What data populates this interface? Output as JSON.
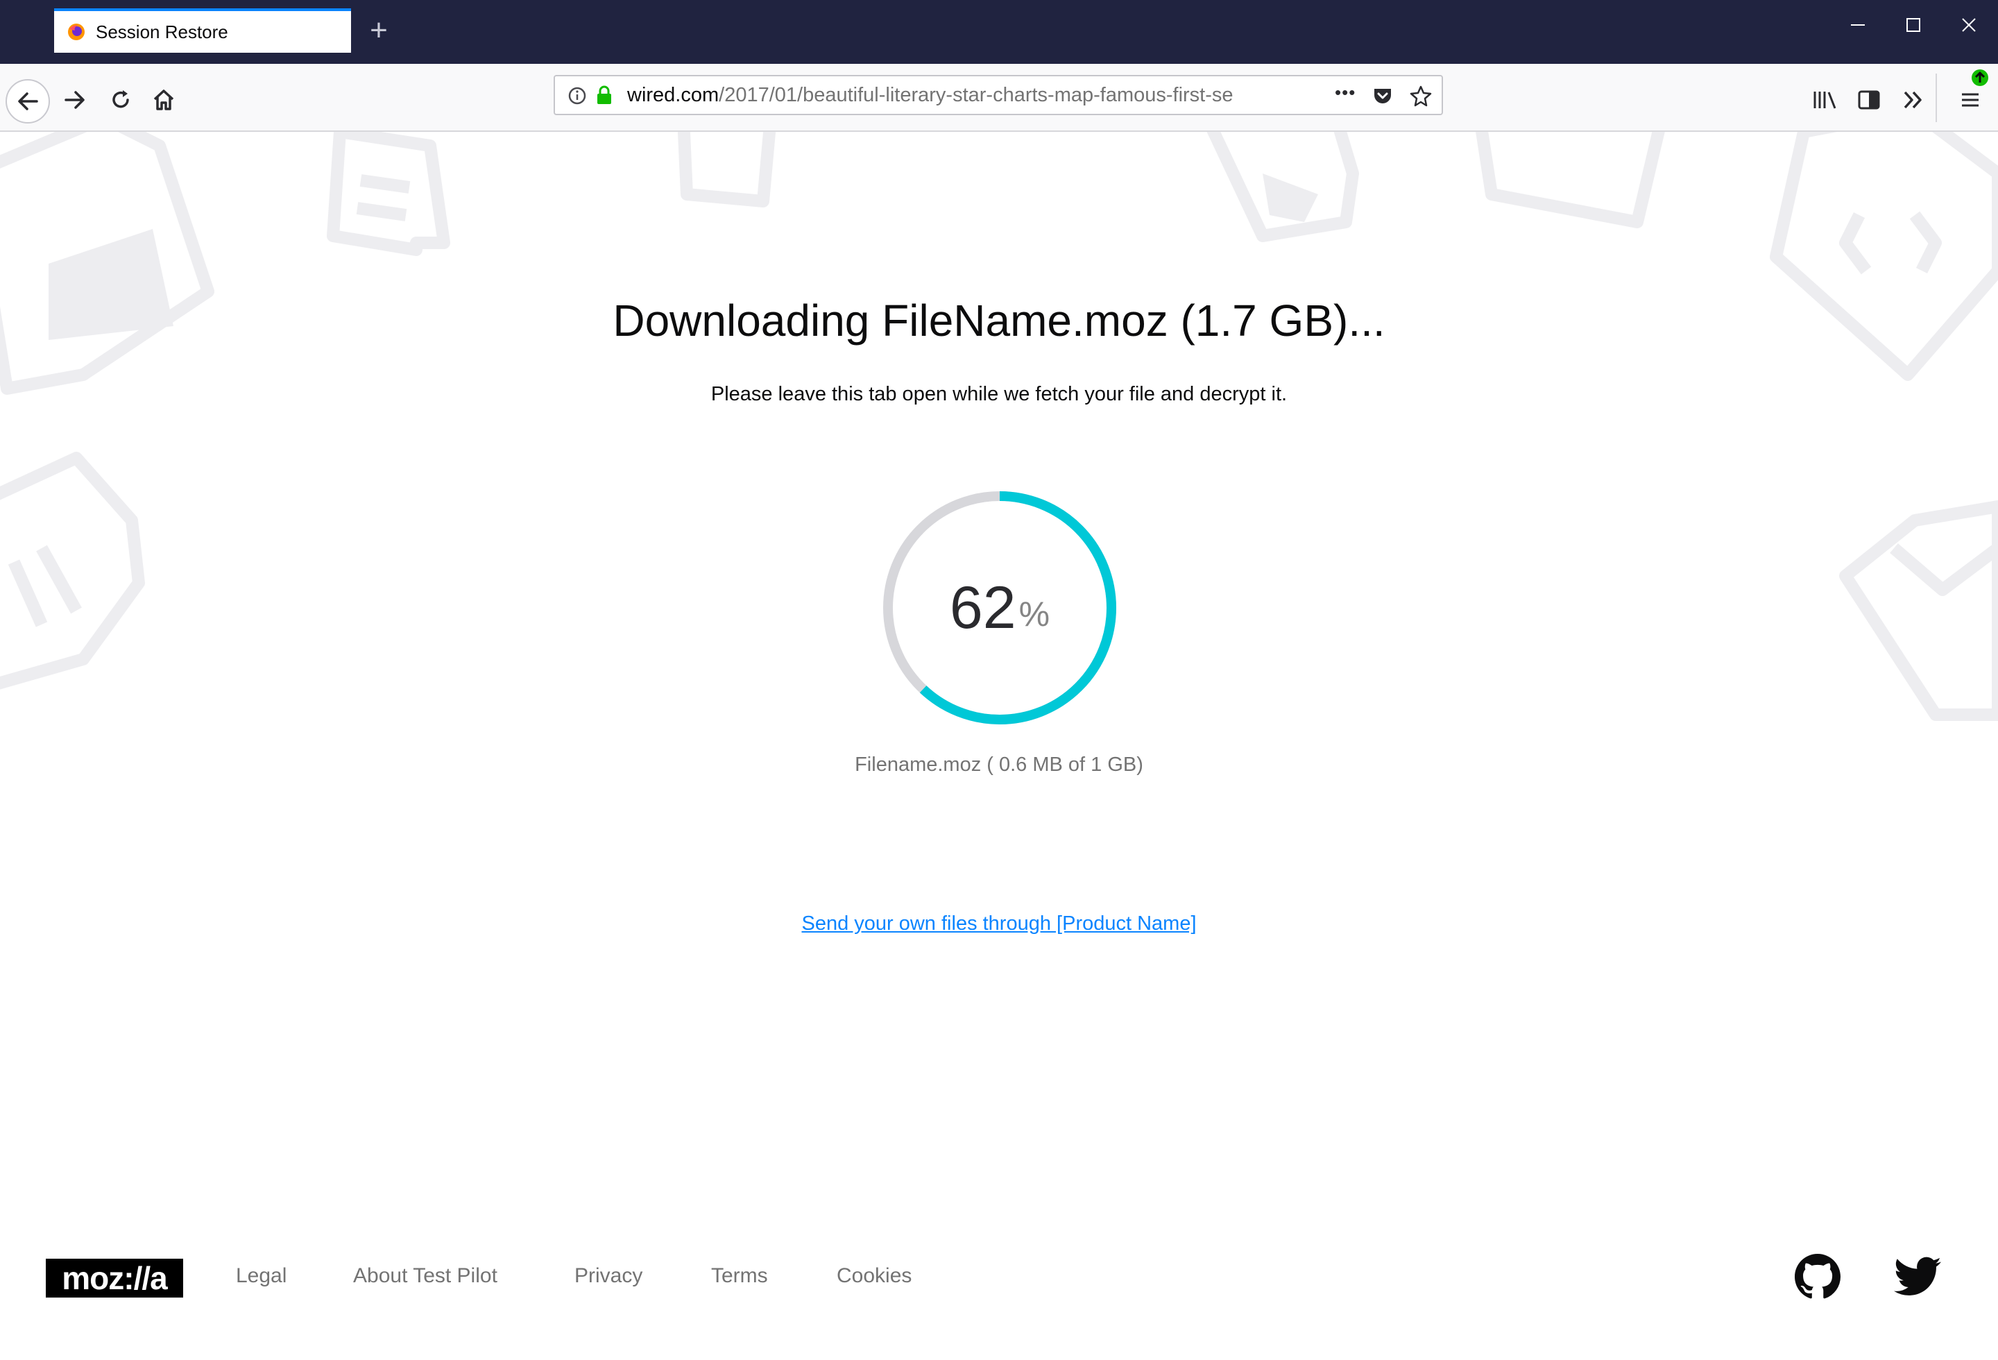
{
  "browser": {
    "tab_title": "Session Restore",
    "new_tab_label": "+",
    "url_host": "wired.com",
    "url_path": "/2017/01/beautiful-literary-star-charts-map-famous-first-se",
    "menu_more": "•••"
  },
  "page": {
    "headline": "Downloading FileName.moz (1.7 GB)...",
    "subline": "Please leave this tab open while we fetch your file and decrypt it.",
    "progress": {
      "percent_value": "62",
      "percent_sign": "%",
      "fraction": 0.62,
      "track_color": "#d7d7db",
      "fill_color": "#00c8d7"
    },
    "file_progress": "Filename.moz ( 0.6 MB of 1 GB)",
    "send_link": "Send your own files through [Product Name]"
  },
  "footer": {
    "logo": "moz://a",
    "links": [
      "Legal",
      "About Test Pilot",
      "Privacy",
      "Terms",
      "Cookies"
    ],
    "social": [
      "github-icon",
      "twitter-icon"
    ]
  },
  "colors": {
    "titlebar": "#202340",
    "accent": "#0a84ff",
    "progress": "#00c8d7"
  }
}
